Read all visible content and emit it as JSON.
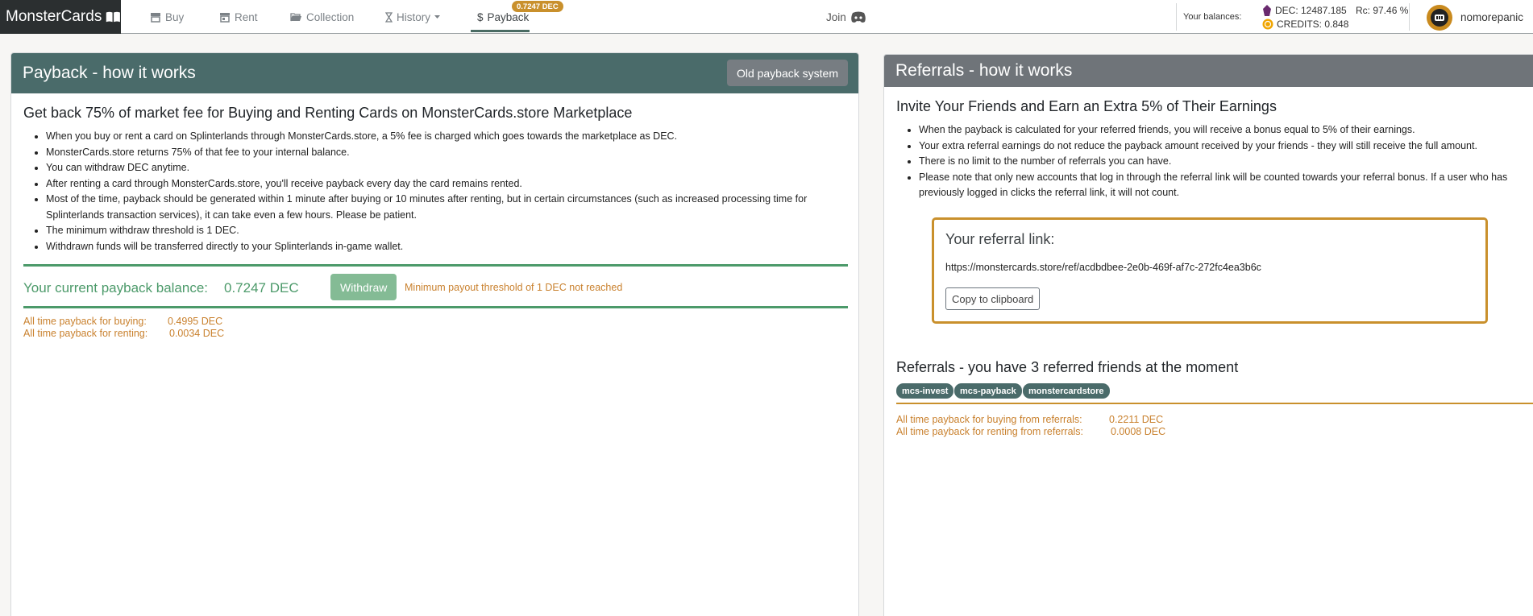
{
  "brand": {
    "name": "MonsterCards"
  },
  "nav": {
    "buy": "Buy",
    "rent": "Rent",
    "collection": "Collection",
    "history": "History",
    "payback": "Payback",
    "payback_badge": "0.7247 DEC",
    "join": "Join"
  },
  "balances": {
    "label": "Your balances:",
    "dec": "DEC: 12487.185",
    "credits": "CREDITS: 0.848",
    "rc": "Rc: 97.46 %"
  },
  "user": {
    "name": "nomorepanic"
  },
  "payback": {
    "header": "Payback - how it works",
    "old_button": "Old payback system",
    "subtitle": "Get back 75% of market fee for Buying and Renting Cards on MonsterCards.store Marketplace",
    "bullets": [
      "When you buy or rent a card on Splinterlands through MonsterCards.store, a 5% fee is charged which goes towards the marketplace as DEC.",
      "MonsterCards.store returns 75% of that fee to your internal balance.",
      "You can withdraw DEC anytime.",
      "After renting a card through MonsterCards.store, you'll receive payback every day the card remains rented.",
      "Most of the time, payback should be generated within 1 minute after buying or 10 minutes after renting, but in certain circumstances (such as increased processing time for Splinterlands transaction services), it can take even a few hours. Please be patient.",
      "The minimum withdraw threshold is 1 DEC.",
      "Withdrawn funds will be transferred directly to your Splinterlands in-game wallet."
    ],
    "balance_label": "Your current payback balance:",
    "balance_value": "0.7247 DEC",
    "withdraw_button": "Withdraw",
    "threshold_note": "Minimum payout threshold of 1 DEC not reached",
    "all_time_buying_label": "All time payback for buying:",
    "all_time_buying_value": "0.4995 DEC",
    "all_time_renting_label": "All time payback for renting:",
    "all_time_renting_value": "0.0034 DEC"
  },
  "referrals": {
    "header": "Referrals - how it works",
    "subtitle": "Invite Your Friends and Earn an Extra 5% of Their Earnings",
    "bullets": [
      "When the payback is calculated for your referred friends, you will receive a bonus equal to 5% of their earnings.",
      "Your extra referral earnings do not reduce the payback amount received by your friends - they will still receive the full amount.",
      "There is no limit to the number of referrals you can have.",
      "Please note that only new accounts that log in through the referral link will be counted towards your referral bonus. If a user who has previously logged in clicks the referral link, it will not count."
    ],
    "link_title": "Your referral link:",
    "link_url": "https://monstercards.store/ref/acdbdbee-2e0b-469f-af7c-272fc4ea3b6c",
    "copy_button": "Copy to clipboard",
    "friends_title": "Referrals  - you have 3 referred friends at the moment",
    "friends": [
      "mcs-invest",
      "mcs-payback",
      "monstercardstore"
    ],
    "buying_label": "All time payback for buying from referrals:",
    "buying_value": "0.2211 DEC",
    "renting_label": "All time payback for renting from referrals:",
    "renting_value": "0.0008 DEC"
  }
}
